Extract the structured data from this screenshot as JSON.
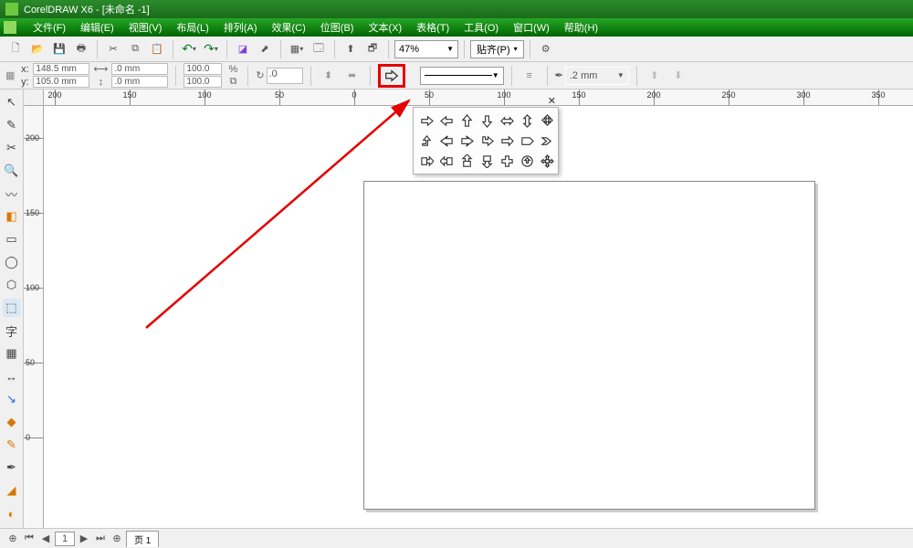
{
  "title": "CorelDRAW X6 - [未命名 -1]",
  "menu": [
    "文件(F)",
    "编辑(E)",
    "视图(V)",
    "布局(L)",
    "排列(A)",
    "效果(C)",
    "位图(B)",
    "文本(X)",
    "表格(T)",
    "工具(O)",
    "窗口(W)",
    "帮助(H)"
  ],
  "toolbar1": {
    "zoom": "47%",
    "snap": "贴齐(P)"
  },
  "toolbar2": {
    "x_label": "x:",
    "y_label": "y:",
    "x_value": "148.5 mm",
    "y_value": "105.0 mm",
    "w_value": ".0 mm",
    "h_value": ".0 mm",
    "scale_x": "100.0",
    "scale_y": "100.0",
    "rotation": ".0",
    "outline_width": ".2 mm"
  },
  "flyout": {
    "rows": [
      [
        "arrow-right",
        "arrow-left",
        "arrow-up",
        "arrow-down",
        "arrow-leftright",
        "arrow-updown",
        "arrow-quad"
      ],
      [
        "arrow-bent-up",
        "arrow-notch-left",
        "arrow-notch-right",
        "arrow-right-turn",
        "arrow-right-alt",
        "arrow-pentagon",
        "arrow-chevron"
      ],
      [
        "arrow-right-box",
        "arrow-left-box",
        "arrow-up-box",
        "arrow-down-callout",
        "arrow-plus",
        "arrow-circle",
        "arrow-quad-callout"
      ]
    ]
  },
  "ruler_h": [
    {
      "pos": 12,
      "label": "200"
    },
    {
      "pos": 94,
      "label": "150"
    },
    {
      "pos": 176,
      "label": "100"
    },
    {
      "pos": 258,
      "label": "50"
    },
    {
      "pos": 340,
      "label": "0"
    },
    {
      "pos": 422,
      "label": "50"
    },
    {
      "pos": 504,
      "label": "100"
    },
    {
      "pos": 586,
      "label": "150"
    },
    {
      "pos": 668,
      "label": "200"
    },
    {
      "pos": 750,
      "label": "250"
    },
    {
      "pos": 832,
      "label": "300"
    },
    {
      "pos": 914,
      "label": "350"
    }
  ],
  "ruler_v": [
    {
      "pos": 35,
      "label": "200"
    },
    {
      "pos": 117,
      "label": "150"
    },
    {
      "pos": 199,
      "label": "100"
    },
    {
      "pos": 281,
      "label": "50"
    },
    {
      "pos": 363,
      "label": "0"
    }
  ],
  "toolbox": [
    {
      "name": "pick-tool",
      "glyph": "↖",
      "cls": ""
    },
    {
      "name": "shape-tool",
      "glyph": "✎",
      "cls": ""
    },
    {
      "name": "crop-tool",
      "glyph": "✂",
      "cls": ""
    },
    {
      "name": "zoom-tool",
      "glyph": "🔍",
      "cls": ""
    },
    {
      "name": "freehand-tool",
      "glyph": "〰",
      "cls": ""
    },
    {
      "name": "smart-fill-tool",
      "glyph": "◧",
      "cls": "orange"
    },
    {
      "name": "rectangle-tool",
      "glyph": "▭",
      "cls": ""
    },
    {
      "name": "ellipse-tool",
      "glyph": "◯",
      "cls": ""
    },
    {
      "name": "polygon-tool",
      "glyph": "⬡",
      "cls": ""
    },
    {
      "name": "perfect-shapes-tool",
      "glyph": "⬚",
      "cls": "active"
    },
    {
      "name": "text-tool",
      "glyph": "字",
      "cls": ""
    },
    {
      "name": "table-tool",
      "glyph": "▦",
      "cls": ""
    },
    {
      "name": "dimension-tool",
      "glyph": "↔",
      "cls": ""
    },
    {
      "name": "connector-tool",
      "glyph": "↘",
      "cls": "blue"
    },
    {
      "name": "interactive-tool",
      "glyph": "◆",
      "cls": "orange"
    },
    {
      "name": "eyedropper-tool",
      "glyph": "✎",
      "cls": "orange"
    },
    {
      "name": "outline-tool",
      "glyph": "✒",
      "cls": ""
    },
    {
      "name": "fill-tool",
      "glyph": "◢",
      "cls": "orange"
    },
    {
      "name": "interactive-fill-tool",
      "glyph": "◐",
      "cls": "orange"
    }
  ],
  "status": {
    "page_tab": "页 1"
  }
}
